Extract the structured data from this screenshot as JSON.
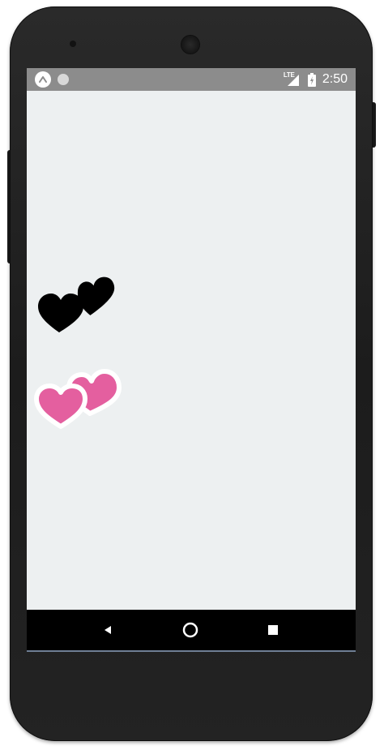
{
  "status_bar": {
    "time": "2:50",
    "network_label": "LTE",
    "icons": [
      "app-launcher-icon",
      "notification-dot-icon",
      "lte-signal-icon",
      "battery-charging-icon"
    ]
  },
  "content": {
    "background_color": "#edf0f1",
    "stickers": [
      {
        "name": "black-double-heart",
        "color": "#000000"
      },
      {
        "name": "pink-double-heart",
        "color": "#e45f9f",
        "outline": "#ffffff"
      }
    ]
  },
  "nav_bar": {
    "buttons": [
      "back-button",
      "home-button",
      "recents-button"
    ]
  },
  "colors": {
    "status_bar": "#8c8c8c",
    "nav_bar": "#000000",
    "device_body": "#1f1f1f",
    "accent_pink": "#e45f9f"
  }
}
